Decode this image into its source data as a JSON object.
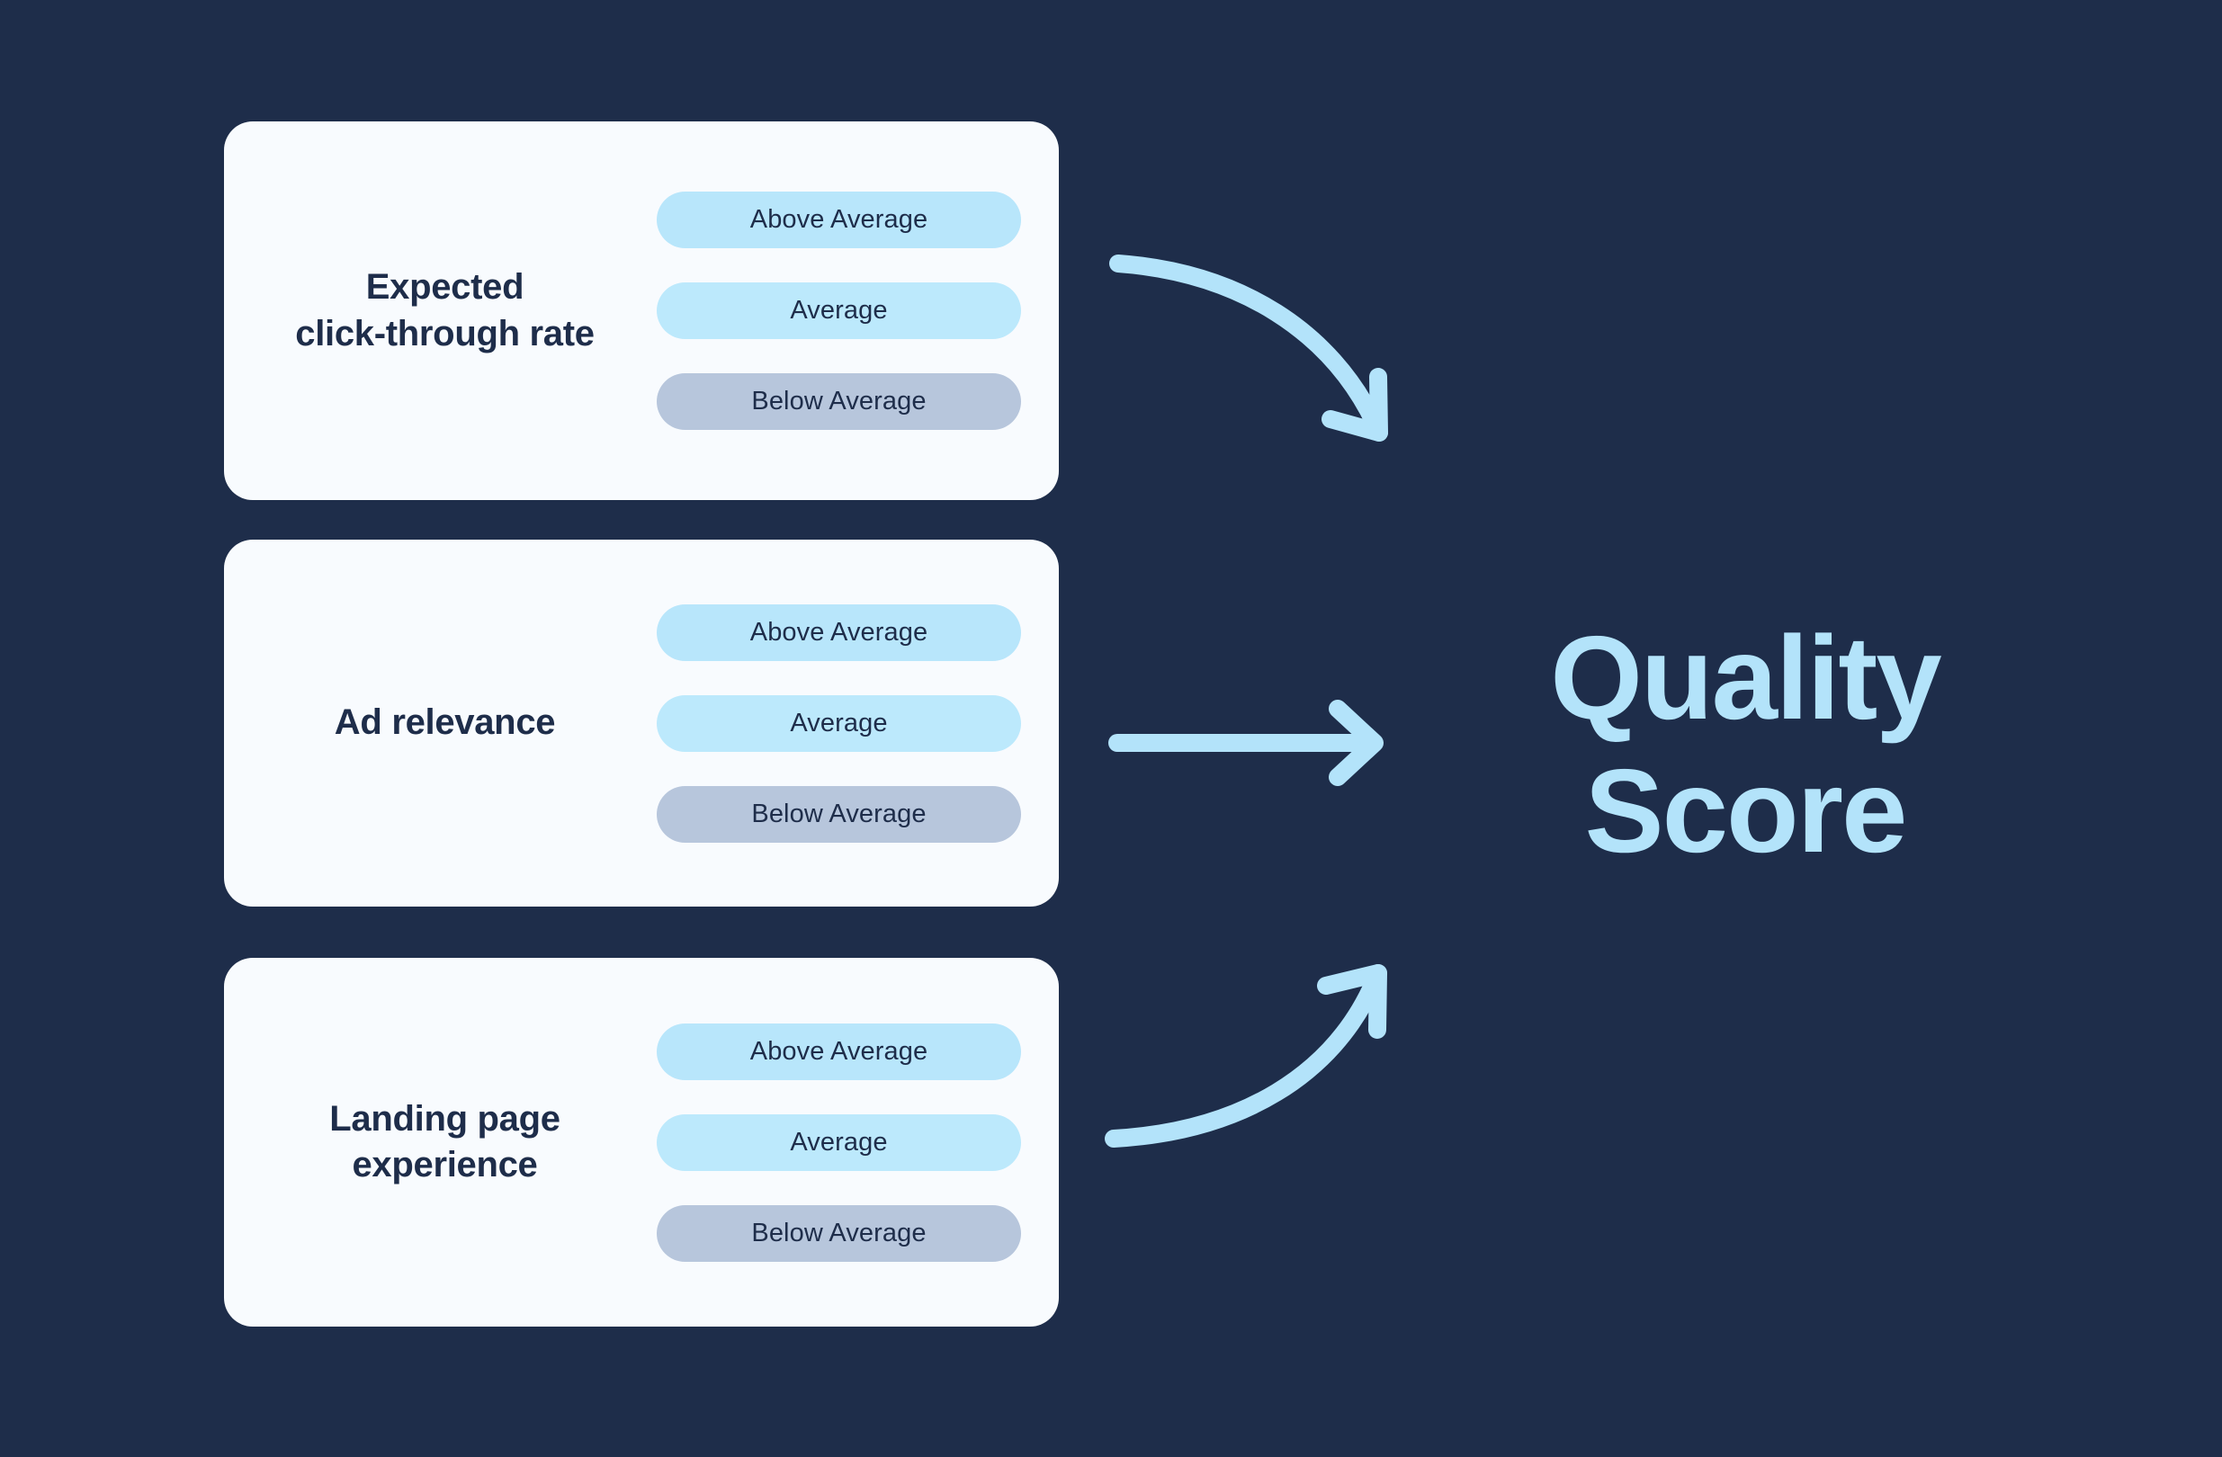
{
  "theme": {
    "background": "#1e2d4a",
    "card_background": "#f8fbfe",
    "label_color": "#1e2d4a",
    "accent_light_blue": "#b3e3fa",
    "pill_above_average": "#b8e6fb",
    "pill_average": "#bce9fc",
    "pill_below_average": "#b7c6dc",
    "arrow_color": "#b3e3fa"
  },
  "diagram": {
    "type": "inputs-to-output",
    "result_label": "Quality\nScore",
    "factors": [
      {
        "label": "Expected\nclick-through rate",
        "ratings": [
          {
            "label": "Above Average",
            "tone": "above"
          },
          {
            "label": "Average",
            "tone": "avg"
          },
          {
            "label": "Below Average",
            "tone": "below"
          }
        ],
        "arrow": "curve-down-right"
      },
      {
        "label": "Ad relevance",
        "ratings": [
          {
            "label": "Above Average",
            "tone": "above"
          },
          {
            "label": "Average",
            "tone": "avg"
          },
          {
            "label": "Below Average",
            "tone": "below"
          }
        ],
        "arrow": "straight-right"
      },
      {
        "label": "Landing page\nexperience",
        "ratings": [
          {
            "label": "Above Average",
            "tone": "above"
          },
          {
            "label": "Average",
            "tone": "avg"
          },
          {
            "label": "Below Average",
            "tone": "below"
          }
        ],
        "arrow": "curve-up-right"
      }
    ]
  }
}
